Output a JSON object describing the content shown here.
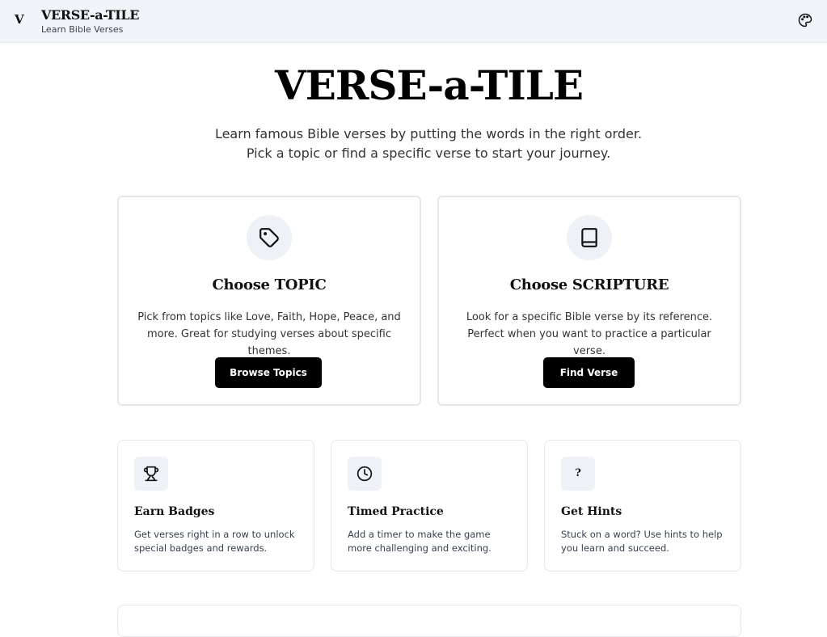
{
  "header": {
    "logo_mark": "V",
    "title": "VERSE-a-TILE",
    "subtitle": "Learn Bible Verses",
    "theme_icon": "palette-icon"
  },
  "hero": {
    "title": "VERSE-a-TILE",
    "description": "Learn famous Bible verses by putting the words in the right order. Pick a topic or find a specific verse to start your journey."
  },
  "choices": [
    {
      "icon": "tag-icon",
      "title": "Choose TOPIC",
      "description": "Pick from topics like Love, Faith, Hope, Peace, and more. Great for studying verses about specific themes.",
      "button_label": "Browse Topics"
    },
    {
      "icon": "book-icon",
      "title": "Choose SCRIPTURE",
      "description": "Look for a specific Bible verse by its reference. Perfect when you want to practice a particular verse.",
      "button_label": "Find Verse"
    }
  ],
  "features": [
    {
      "icon": "trophy-icon",
      "title": "Earn Badges",
      "description": "Get verses right in a row to unlock special badges and rewards."
    },
    {
      "icon": "clock-icon",
      "title": "Timed Practice",
      "description": "Add a timer to make the game more challenging and exciting."
    },
    {
      "icon": "question-icon",
      "icon_text": "?",
      "title": "Get Hints",
      "description": "Stuck on a word? Use hints to help you learn and succeed."
    }
  ],
  "colors": {
    "header_bg": "#f1f5f9",
    "button_bg": "#000000",
    "icon_bg": "#eef2f6",
    "border": "#e5e7eb"
  }
}
